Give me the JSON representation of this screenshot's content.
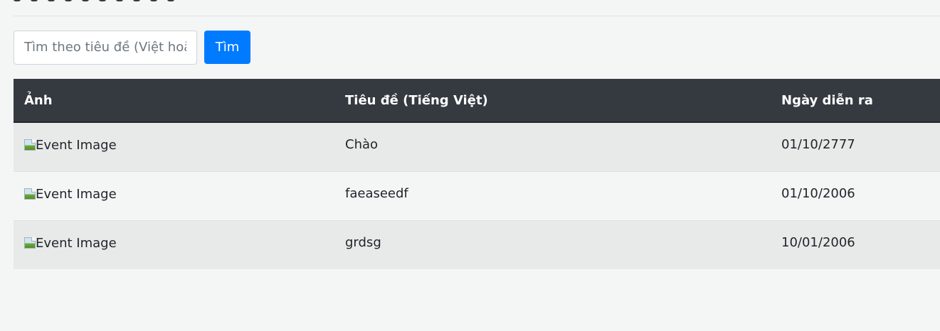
{
  "search": {
    "placeholder": "Tìm theo tiêu đề (Việt hoặc Anh)",
    "button_label": "Tìm"
  },
  "table": {
    "headers": {
      "image": "Ảnh",
      "title": "Tiêu đề (Tiếng Việt)",
      "date": "Ngày diễn ra"
    },
    "rows": [
      {
        "image_alt": "Event Image",
        "title": "Chào",
        "date": "01/10/2777"
      },
      {
        "image_alt": "Event Image",
        "title": "faeaseedf",
        "date": "01/10/2006"
      },
      {
        "image_alt": "Event Image",
        "title": "grdsg",
        "date": "10/01/2006"
      }
    ]
  },
  "colors": {
    "primary": "#007bff",
    "table_header": "#343a40",
    "background": "#f4f6f6"
  },
  "icons": {
    "broken_image": "broken-image-icon"
  }
}
